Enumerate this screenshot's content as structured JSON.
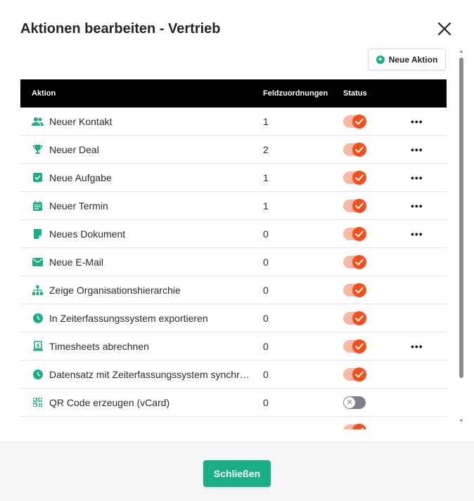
{
  "dialog": {
    "title": "Aktionen bearbeiten - Vertrieb",
    "new_action_label": "Neue Aktion",
    "close_button_label": "Schließen"
  },
  "table": {
    "headers": {
      "action": "Aktion",
      "field_mappings": "Feldzuordnungen",
      "status": "Status"
    },
    "rows": [
      {
        "icon": "contacts-icon",
        "name": "Neuer Kontakt",
        "fields": "1",
        "status": "on",
        "menu": true
      },
      {
        "icon": "trophy-icon",
        "name": "Neuer Deal",
        "fields": "2",
        "status": "on",
        "menu": true
      },
      {
        "icon": "checkbox-icon",
        "name": "Neue Aufgabe",
        "fields": "1",
        "status": "on",
        "menu": true
      },
      {
        "icon": "calendar-icon",
        "name": "Neuer Termin",
        "fields": "1",
        "status": "on",
        "menu": true
      },
      {
        "icon": "document-icon",
        "name": "Neues Dokument",
        "fields": "0",
        "status": "on",
        "menu": true
      },
      {
        "icon": "mail-icon",
        "name": "Neue E-Mail",
        "fields": "0",
        "status": "on",
        "menu": false
      },
      {
        "icon": "hierarchy-icon",
        "name": "Zeige Organisationshierarchie",
        "fields": "0",
        "status": "on",
        "menu": false
      },
      {
        "icon": "clock-icon",
        "name": "In Zeiterfassungssystem exportieren",
        "fields": "0",
        "status": "on",
        "menu": false
      },
      {
        "icon": "invoice-icon",
        "name": "Timesheets abrechnen",
        "fields": "0",
        "status": "on",
        "menu": true
      },
      {
        "icon": "clock-icon",
        "name": "Datensatz mit Zeiterfassungssystem synchronisieren",
        "fields": "0",
        "status": "on",
        "menu": false
      },
      {
        "icon": "qr-code-icon",
        "name": "QR Code erzeugen (vCard)",
        "fields": "0",
        "status": "off",
        "menu": false
      },
      {
        "icon": "",
        "name": "",
        "fields": "",
        "status": "on",
        "menu": false
      }
    ]
  },
  "colors": {
    "accent": "#1aae86",
    "toggle_on": "#f44e1a",
    "toggle_on_track": "#f9b7a5",
    "toggle_off": "#7d808c",
    "header_bg": "#000000"
  }
}
